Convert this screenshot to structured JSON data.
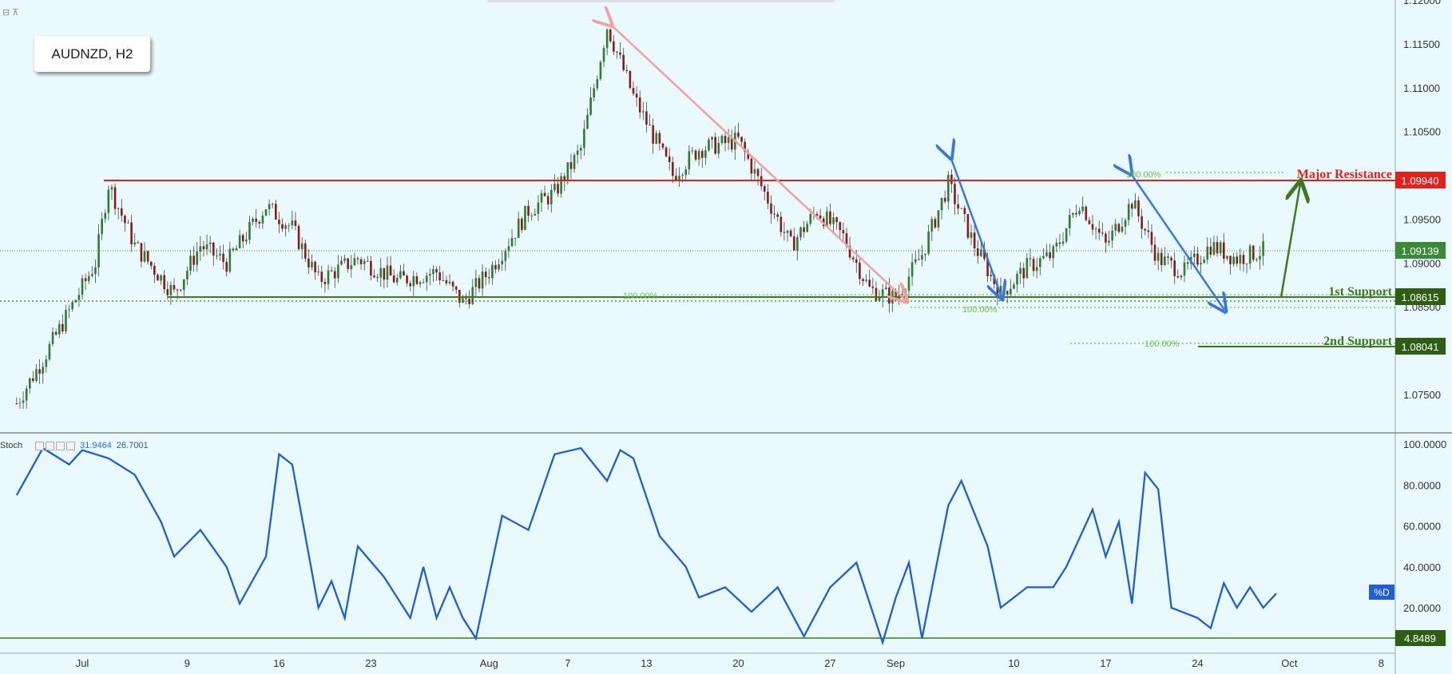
{
  "symbol_label": "AUDNZD, H2",
  "stoch": {
    "name": "Stoch",
    "k_value": "31.9464",
    "d_value": "26.7001",
    "d_badge": "%D",
    "level_badge": "4.8489"
  },
  "annotations": {
    "major_resistance": "Major Resistance",
    "first_support": "1st Support",
    "second_support": "2nd Support",
    "fib_labels": [
      "100.00%",
      "100.00%",
      "100.00%",
      "100.00%"
    ]
  },
  "price_badges": {
    "resistance": "1.09940",
    "current": "1.09139",
    "first_support": "1.08615",
    "second_support": "1.08041"
  },
  "colors": {
    "background": "#e9f9fd",
    "resistance": "#e2201c",
    "support": "#3d7a1f",
    "current_price": "#3a8a3a",
    "stoch_line": "#1f5fd1",
    "pink_arrow": "#f0a0a0",
    "blue_arrow": "#3a78d8",
    "up_candle": "#2e7d32",
    "down_candle": "#8b1a1a"
  },
  "chart_data": [
    {
      "type": "candlestick",
      "symbol": "AUDNZD",
      "timeframe": "H2",
      "x_tick_labels": [
        "Jul",
        "9",
        "16",
        "23",
        "Aug",
        "7",
        "13",
        "20",
        "27",
        "Sep",
        "10",
        "17",
        "24",
        "Oct",
        "8"
      ],
      "y_tick_labels": [
        "1.12000",
        "1.11500",
        "1.11000",
        "1.10500",
        "1.09500",
        "1.09000",
        "1.08500",
        "1.07500"
      ],
      "ylim": [
        1.0715,
        1.12
      ],
      "levels": {
        "major_resistance": 1.0994,
        "first_support": 1.08615,
        "second_support": 1.08041,
        "current": 1.09139
      },
      "close_path": [
        [
          "2018-06-26",
          1.074
        ],
        [
          "2018-06-28",
          1.079
        ],
        [
          "2018-07-02",
          1.09
        ],
        [
          "2018-07-03",
          1.099
        ],
        [
          "2018-07-05",
          1.092
        ],
        [
          "2018-07-08",
          1.0865
        ],
        [
          "2018-07-10",
          1.092
        ],
        [
          "2018-07-12",
          1.09
        ],
        [
          "2018-07-15",
          1.0965
        ],
        [
          "2018-07-17",
          1.094
        ],
        [
          "2018-07-19",
          1.088
        ],
        [
          "2018-07-22",
          1.0905
        ],
        [
          "2018-07-25",
          1.088
        ],
        [
          "2018-07-28",
          1.089
        ],
        [
          "2018-07-30",
          1.0855
        ],
        [
          "2018-08-01",
          1.089
        ],
        [
          "2018-08-04",
          1.096
        ],
        [
          "2018-08-06",
          1.098
        ],
        [
          "2018-08-08",
          1.103
        ],
        [
          "2018-08-10",
          1.117
        ],
        [
          "2018-08-12",
          1.109
        ],
        [
          "2018-08-15",
          1.1
        ],
        [
          "2018-08-17",
          1.103
        ],
        [
          "2018-08-20",
          1.104
        ],
        [
          "2018-08-22",
          1.098
        ],
        [
          "2018-08-24",
          1.092
        ],
        [
          "2018-08-26",
          1.096
        ],
        [
          "2018-08-28",
          1.093
        ],
        [
          "2018-08-30",
          1.087
        ],
        [
          "2018-09-01",
          1.086
        ],
        [
          "2018-09-03",
          1.091
        ],
        [
          "2018-09-05",
          1.099
        ],
        [
          "2018-09-07",
          1.092
        ],
        [
          "2018-09-09",
          1.0865
        ],
        [
          "2018-09-11",
          1.0895
        ],
        [
          "2018-09-13",
          1.091
        ],
        [
          "2018-09-15",
          1.097
        ],
        [
          "2018-09-17",
          1.092
        ],
        [
          "2018-09-19",
          1.097
        ],
        [
          "2018-09-21",
          1.0905
        ],
        [
          "2018-09-23",
          1.089
        ],
        [
          "2018-09-25",
          1.092
        ],
        [
          "2018-09-27",
          1.0905
        ],
        [
          "2018-09-29",
          1.0914
        ]
      ]
    },
    {
      "type": "line",
      "name": "Stoch",
      "ylim": [
        0,
        100
      ],
      "y_tick_labels": [
        "100.0000",
        "80.0000",
        "60.0000",
        "40.0000",
        "20.0000"
      ],
      "level": 4.8489,
      "series": [
        {
          "name": "%D",
          "points": [
            [
              "2018-06-26",
              75
            ],
            [
              "2018-06-28",
              98
            ],
            [
              "2018-06-30",
              90
            ],
            [
              "2018-07-01",
              97
            ],
            [
              "2018-07-03",
              93
            ],
            [
              "2018-07-05",
              85
            ],
            [
              "2018-07-07",
              62
            ],
            [
              "2018-07-08",
              45
            ],
            [
              "2018-07-10",
              58
            ],
            [
              "2018-07-12",
              40
            ],
            [
              "2018-07-13",
              22
            ],
            [
              "2018-07-15",
              45
            ],
            [
              "2018-07-16",
              95
            ],
            [
              "2018-07-17",
              90
            ],
            [
              "2018-07-19",
              20
            ],
            [
              "2018-07-20",
              33
            ],
            [
              "2018-07-21",
              15
            ],
            [
              "2018-07-22",
              50
            ],
            [
              "2018-07-24",
              35
            ],
            [
              "2018-07-26",
              15
            ],
            [
              "2018-07-27",
              40
            ],
            [
              "2018-07-28",
              15
            ],
            [
              "2018-07-29",
              30
            ],
            [
              "2018-07-30",
              15
            ],
            [
              "2018-07-31",
              5
            ],
            [
              "2018-08-02",
              65
            ],
            [
              "2018-08-04",
              58
            ],
            [
              "2018-08-06",
              95
            ],
            [
              "2018-08-08",
              98
            ],
            [
              "2018-08-10",
              82
            ],
            [
              "2018-08-11",
              97
            ],
            [
              "2018-08-12",
              93
            ],
            [
              "2018-08-14",
              55
            ],
            [
              "2018-08-16",
              40
            ],
            [
              "2018-08-17",
              25
            ],
            [
              "2018-08-19",
              30
            ],
            [
              "2018-08-21",
              18
            ],
            [
              "2018-08-23",
              30
            ],
            [
              "2018-08-25",
              6
            ],
            [
              "2018-08-27",
              30
            ],
            [
              "2018-08-29",
              42
            ],
            [
              "2018-08-31",
              3
            ],
            [
              "2018-09-01",
              25
            ],
            [
              "2018-09-02",
              42
            ],
            [
              "2018-09-03",
              5
            ],
            [
              "2018-09-05",
              70
            ],
            [
              "2018-09-06",
              82
            ],
            [
              "2018-09-08",
              50
            ],
            [
              "2018-09-09",
              20
            ],
            [
              "2018-09-11",
              30
            ],
            [
              "2018-09-13",
              30
            ],
            [
              "2018-09-14",
              40
            ],
            [
              "2018-09-16",
              68
            ],
            [
              "2018-09-17",
              45
            ],
            [
              "2018-09-18",
              62
            ],
            [
              "2018-09-19",
              22
            ],
            [
              "2018-09-20",
              86
            ],
            [
              "2018-09-21",
              78
            ],
            [
              "2018-09-22",
              20
            ],
            [
              "2018-09-24",
              15
            ],
            [
              "2018-09-25",
              10
            ],
            [
              "2018-09-26",
              32
            ],
            [
              "2018-09-27",
              20
            ],
            [
              "2018-09-28",
              30
            ],
            [
              "2018-09-29",
              20
            ],
            [
              "2018-09-30",
              27
            ]
          ]
        }
      ]
    }
  ]
}
